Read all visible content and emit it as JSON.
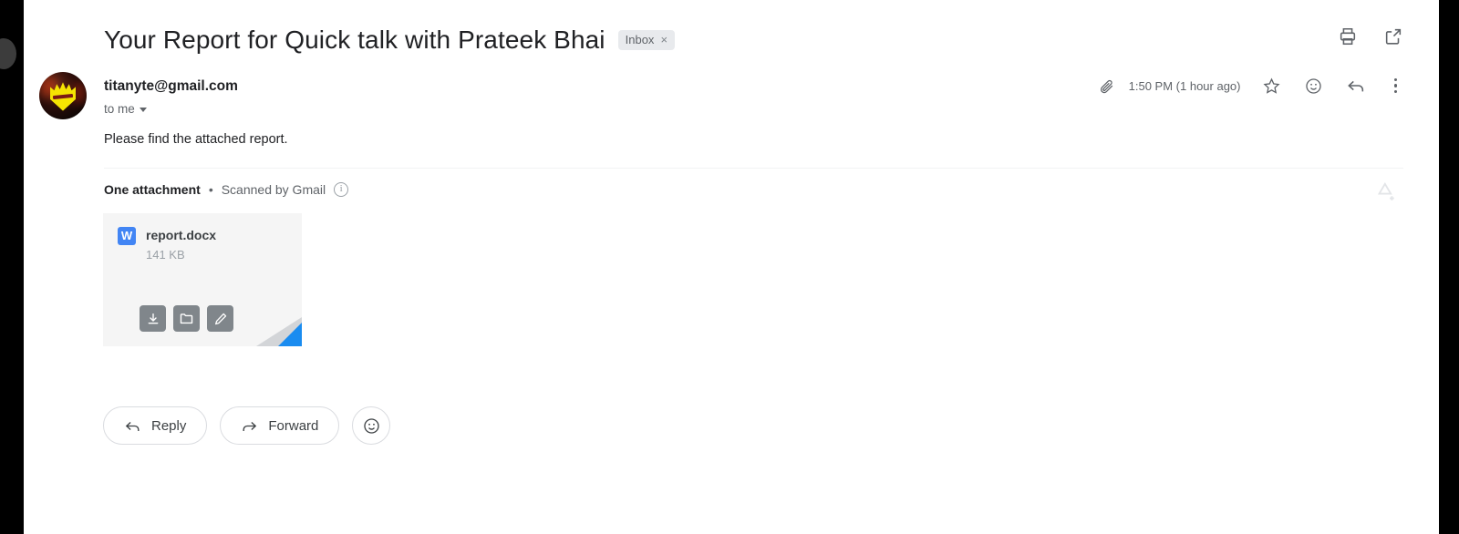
{
  "window": {
    "background_color": "#000000",
    "pane_color": "#ffffff"
  },
  "header": {
    "subject": "Your Report for Quick talk with Prateek Bhai",
    "label_chip": {
      "text": "Inbox",
      "remove_glyph": "×"
    },
    "actions": [
      {
        "name": "print-icon",
        "tooltip": "Print all"
      },
      {
        "name": "open-in-new-window-icon",
        "tooltip": "In new window"
      }
    ]
  },
  "message": {
    "sender": "titanyte@gmail.com",
    "recipient_line": "to me",
    "timestamp": "1:50 PM (1 hour ago)",
    "body": "Please find the attached report.",
    "avatar_colors": {
      "background": "#1a0a08",
      "emblem": "#f5e402"
    },
    "actions": [
      {
        "name": "attachment-indicator-icon"
      },
      {
        "name": "star-icon"
      },
      {
        "name": "add-reaction-icon"
      },
      {
        "name": "reply-icon"
      },
      {
        "name": "more-options-icon"
      }
    ]
  },
  "attachments": {
    "count_label": "One attachment",
    "separator": "•",
    "scanned_label": "Scanned by Gmail",
    "info_glyph": "i",
    "add_all_to_drive": "Add all to Drive",
    "files": [
      {
        "name": "report.docx",
        "size": "141 KB",
        "type_badge": "W",
        "type_color": "#4285f4",
        "accent_color": "#1a8cf0",
        "buttons": [
          {
            "name": "download-attachment-button"
          },
          {
            "name": "save-to-drive-button"
          },
          {
            "name": "edit-attachment-button"
          }
        ]
      }
    ]
  },
  "footer": {
    "reply_label": "Reply",
    "forward_label": "Forward",
    "react_label": ""
  }
}
